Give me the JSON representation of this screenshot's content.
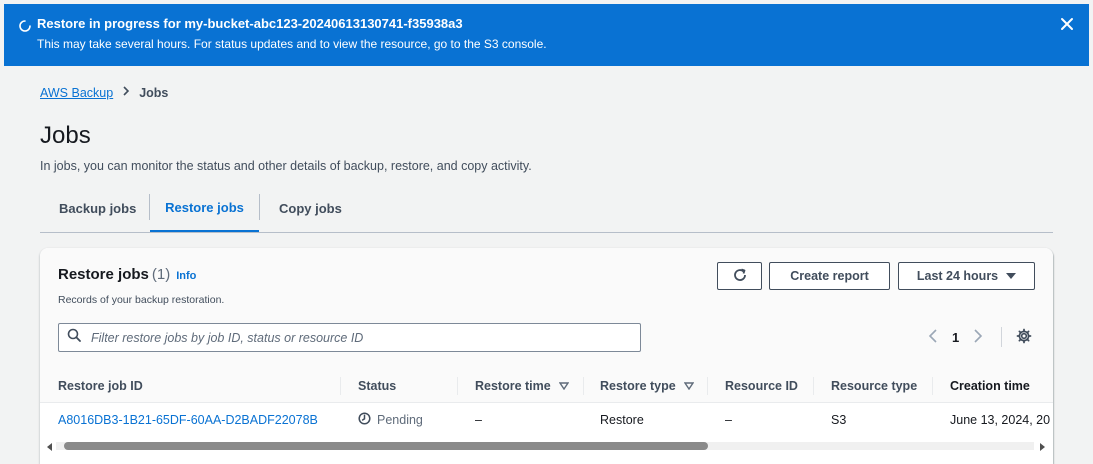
{
  "flash": {
    "title": "Restore in progress for my-bucket-abc123-20240613130741-f35938a3",
    "description": "This may take several hours. For status updates and to view the resource, go to the S3 console.",
    "background": "#0972d3"
  },
  "breadcrumb": {
    "root": "AWS Backup",
    "current": "Jobs"
  },
  "page": {
    "title": "Jobs",
    "description": "In jobs, you can monitor the status and other details of backup, restore, and copy activity."
  },
  "tabs": [
    {
      "label": "Backup jobs",
      "active": false
    },
    {
      "label": "Restore jobs",
      "active": true
    },
    {
      "label": "Copy jobs",
      "active": false
    }
  ],
  "panel": {
    "title": "Restore jobs",
    "count": "(1)",
    "info": "Info",
    "description": "Records of your backup restoration.",
    "create_report": "Create report",
    "time_range": "Last 24 hours",
    "search_placeholder": "Filter restore jobs by job ID, status or resource ID",
    "page_number": "1"
  },
  "table": {
    "columns": [
      "Restore job ID",
      "Status",
      "Restore time",
      "Restore type",
      "Resource ID",
      "Resource type",
      "Creation time"
    ],
    "rows": [
      {
        "job_id": "A8016DB3-1B21-65DF-60AA-D2BADF22078B",
        "status": "Pending",
        "restore_time": "–",
        "restore_type": "Restore",
        "resource_id": "–",
        "resource_type": "S3",
        "creation_time": "June 13, 2024, 20"
      }
    ]
  },
  "colors": {
    "accent": "#0972d3",
    "text": "#16191f",
    "muted": "#414d5c"
  }
}
